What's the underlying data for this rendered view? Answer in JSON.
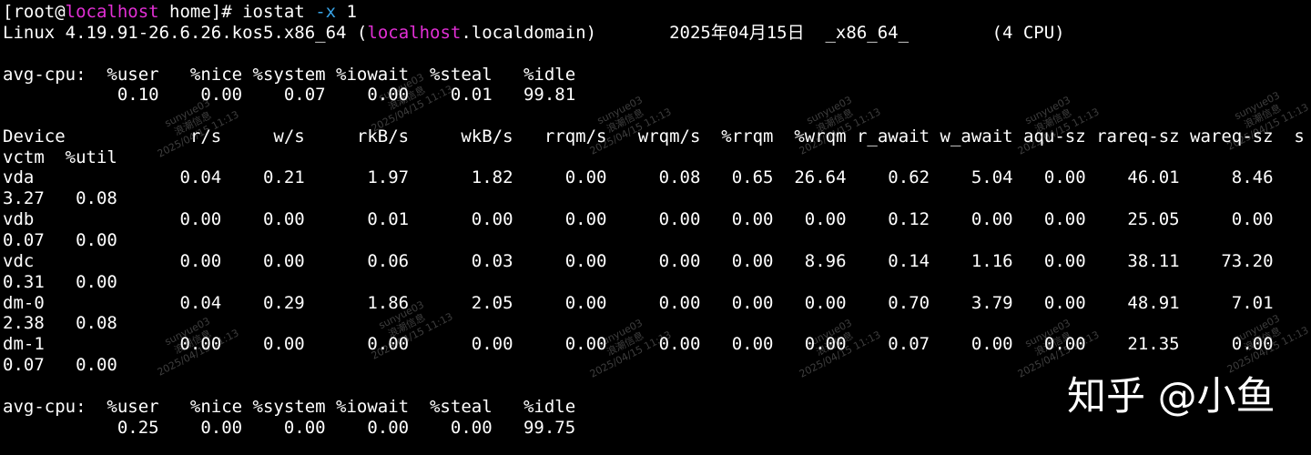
{
  "terminal": {
    "prompt_text": "[root@",
    "prompt_host": "localhost",
    "prompt_tail": " home]# iostat ",
    "command_option": "-x",
    "command_arg": " 1",
    "sysinfo_pre": "Linux 4.19.91-26.6.26.kos5.x86_64 (",
    "sysinfo_host": "localhost",
    "sysinfo_post": ".localdomain)       2025年04月15日  _x86_64_        (4 CPU)",
    "cpu_blocks": [
      {
        "header": "avg-cpu:  %user   %nice %system %iowait  %steal   %idle",
        "values": "           0.10    0.00    0.07    0.00    0.01   99.81"
      },
      {
        "header": "avg-cpu:  %user   %nice %system %iowait  %steal   %idle",
        "values": "           0.25    0.00    0.00    0.00    0.00   99.75"
      }
    ],
    "device_header_line1": "Device            r/s     w/s     rkB/s     wkB/s   rrqm/s   wrqm/s  %rrqm  %wrqm r_await w_await aqu-sz rareq-sz wareq-sz  s",
    "device_header_line2": "vctm  %util",
    "device_rows": [
      {
        "line1": "vda              0.04    0.21      1.97      1.82     0.00     0.08   0.65  26.64    0.62    5.04   0.00    46.01     8.46",
        "line2": "3.27   0.08"
      },
      {
        "line1": "vdb              0.00    0.00      0.01      0.00     0.00     0.00   0.00   0.00    0.12    0.00   0.00    25.05     0.00",
        "line2": "0.07   0.00"
      },
      {
        "line1": "vdc              0.00    0.00      0.06      0.03     0.00     0.00   0.00   8.96    0.14    1.16   0.00    38.11    73.20",
        "line2": "0.31   0.00"
      },
      {
        "line1": "dm-0             0.04    0.29      1.86      2.05     0.00     0.00   0.00   0.00    0.70    3.79   0.00    48.91     7.01",
        "line2": "2.38   0.08"
      },
      {
        "line1": "dm-1             0.00    0.00      0.00      0.00     0.00     0.00   0.00   0.00    0.07    0.00   0.00    21.35     0.00",
        "line2": "0.07   0.00"
      }
    ]
  },
  "watermark": {
    "user": "sunyue03",
    "company": "浪潮信息",
    "timestamp": "2025/04/15 11:13"
  },
  "zhihu_watermark": "知乎 @小鱼",
  "colors": {
    "background": "#000000",
    "text": "#ffffff",
    "hostname": "#e22fd5",
    "option_flag": "#38a3e6"
  }
}
